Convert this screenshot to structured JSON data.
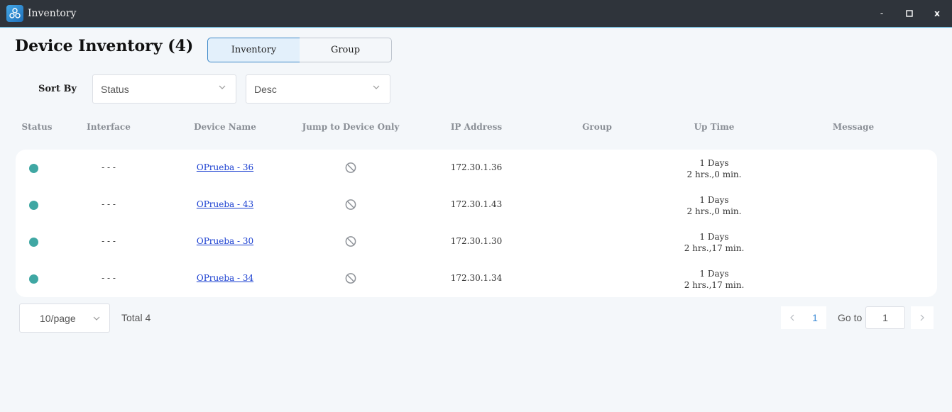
{
  "window": {
    "title": "Inventory",
    "minimize": "-",
    "maximize": "□",
    "close": "x"
  },
  "header": {
    "title": "Device Inventory (4)",
    "tabs": [
      {
        "label": "Inventory",
        "active": true
      },
      {
        "label": "Group",
        "active": false
      }
    ]
  },
  "sort": {
    "label": "Sort By",
    "field": "Status",
    "order": "Desc"
  },
  "table": {
    "columns": [
      "Status",
      "Interface",
      "Device Name",
      "Jump to Device Only",
      "IP Address",
      "Group",
      "Up Time",
      "Message"
    ],
    "rows": [
      {
        "status": "online",
        "interface": "- - -",
        "device_name": "OPrueba - 36",
        "ip": "172.30.1.36",
        "group": "",
        "uptime_days": "1 Days",
        "uptime_time": "2 hrs.,0 min.",
        "message": ""
      },
      {
        "status": "online",
        "interface": "- - -",
        "device_name": "OPrueba - 43",
        "ip": "172.30.1.43",
        "group": "",
        "uptime_days": "1 Days",
        "uptime_time": "2 hrs.,0 min.",
        "message": ""
      },
      {
        "status": "online",
        "interface": "- - -",
        "device_name": "OPrueba - 30",
        "ip": "172.30.1.30",
        "group": "",
        "uptime_days": "1 Days",
        "uptime_time": "2 hrs.,17 min.",
        "message": ""
      },
      {
        "status": "online",
        "interface": "- - -",
        "device_name": "OPrueba - 34",
        "ip": "172.30.1.34",
        "group": "",
        "uptime_days": "1 Days",
        "uptime_time": "2 hrs.,17 min.",
        "message": ""
      }
    ]
  },
  "pagination": {
    "page_size": "10/page",
    "total": "Total 4",
    "current_page": "1",
    "goto_label": "Go to",
    "goto_value": "1"
  },
  "colors": {
    "status_online": "#3fa7a3",
    "link": "#1a3fd1",
    "accent": "#3d88c8"
  }
}
